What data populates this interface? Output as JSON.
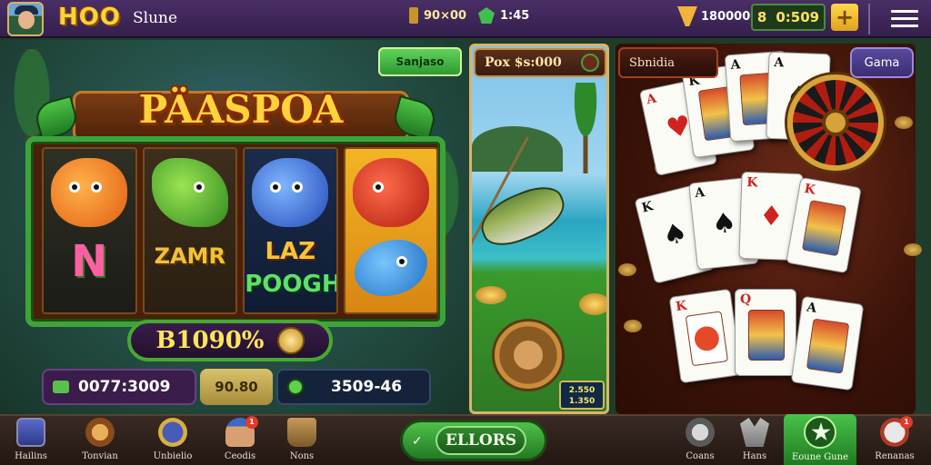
{
  "header": {
    "logo": "HOO",
    "subtitle": "Slune",
    "ticket_value": "90×00",
    "gem_value": "1:45",
    "coin_value": "1800006",
    "balance_digit": "8",
    "balance_value": "0:509",
    "plus_label": "+"
  },
  "slot": {
    "top_button": "Sanjaso",
    "title": "PÄASPOA",
    "reel_texts": {
      "reel1_bottom": "N",
      "reel2_bottom": "ZAMR",
      "reel3_bottom_a": "LAZ",
      "reel3_bottom_b": "POOGH"
    },
    "win_value": "B1090%",
    "stat1_value": "0077:3009",
    "stat2_value": "90.80",
    "stat3_value": "3509-46"
  },
  "fishing": {
    "header": "Pox $s:000",
    "mini_line1": "2.550",
    "mini_line2": "1.350"
  },
  "cards": {
    "label": "Sbnidia",
    "game_button": "Gama",
    "cards": [
      {
        "rank": "A",
        "suit": "♥",
        "color": "red"
      },
      {
        "rank": "K",
        "suit": "♠",
        "color": "black"
      },
      {
        "rank": "A",
        "suit": "♠",
        "color": "black"
      },
      {
        "rank": "A",
        "suit": "♠",
        "color": "black"
      },
      {
        "rank": "K",
        "suit": "♠",
        "color": "black"
      },
      {
        "rank": "K",
        "suit": "♦",
        "color": "red"
      },
      {
        "rank": "K",
        "suit": "♦",
        "color": "red"
      },
      {
        "rank": "K",
        "suit": "♥",
        "color": "red"
      },
      {
        "rank": "Q",
        "suit": "♦",
        "color": "red"
      },
      {
        "rank": "A",
        "suit": "♠",
        "color": "black"
      }
    ]
  },
  "bottom_nav": {
    "items": [
      {
        "label": "Hailins",
        "icon": "tablet-icon",
        "badge": ""
      },
      {
        "label": "Tonvian",
        "icon": "scroll-icon",
        "badge": ""
      },
      {
        "label": "Unbielio",
        "icon": "tower-icon",
        "badge": ""
      },
      {
        "label": "Ceodis",
        "icon": "goblin-icon",
        "badge": "1"
      },
      {
        "label": "Nons",
        "icon": "glove-icon",
        "badge": ""
      },
      {
        "label": "Coans",
        "icon": "pin-icon",
        "badge": ""
      },
      {
        "label": "Hans",
        "icon": "moose-icon",
        "badge": ""
      },
      {
        "label": "Eoune Gune",
        "icon": "star-icon",
        "badge": ""
      },
      {
        "label": "Renanas",
        "icon": "skull-icon",
        "badge": "1"
      }
    ],
    "center_button": "ELLORS",
    "center_chevron": "✓"
  },
  "colors": {
    "topbar": "#4a2e66",
    "accent_green": "#3da43a",
    "gold": "#ffd23a",
    "card_panel": "#6a2a18"
  }
}
